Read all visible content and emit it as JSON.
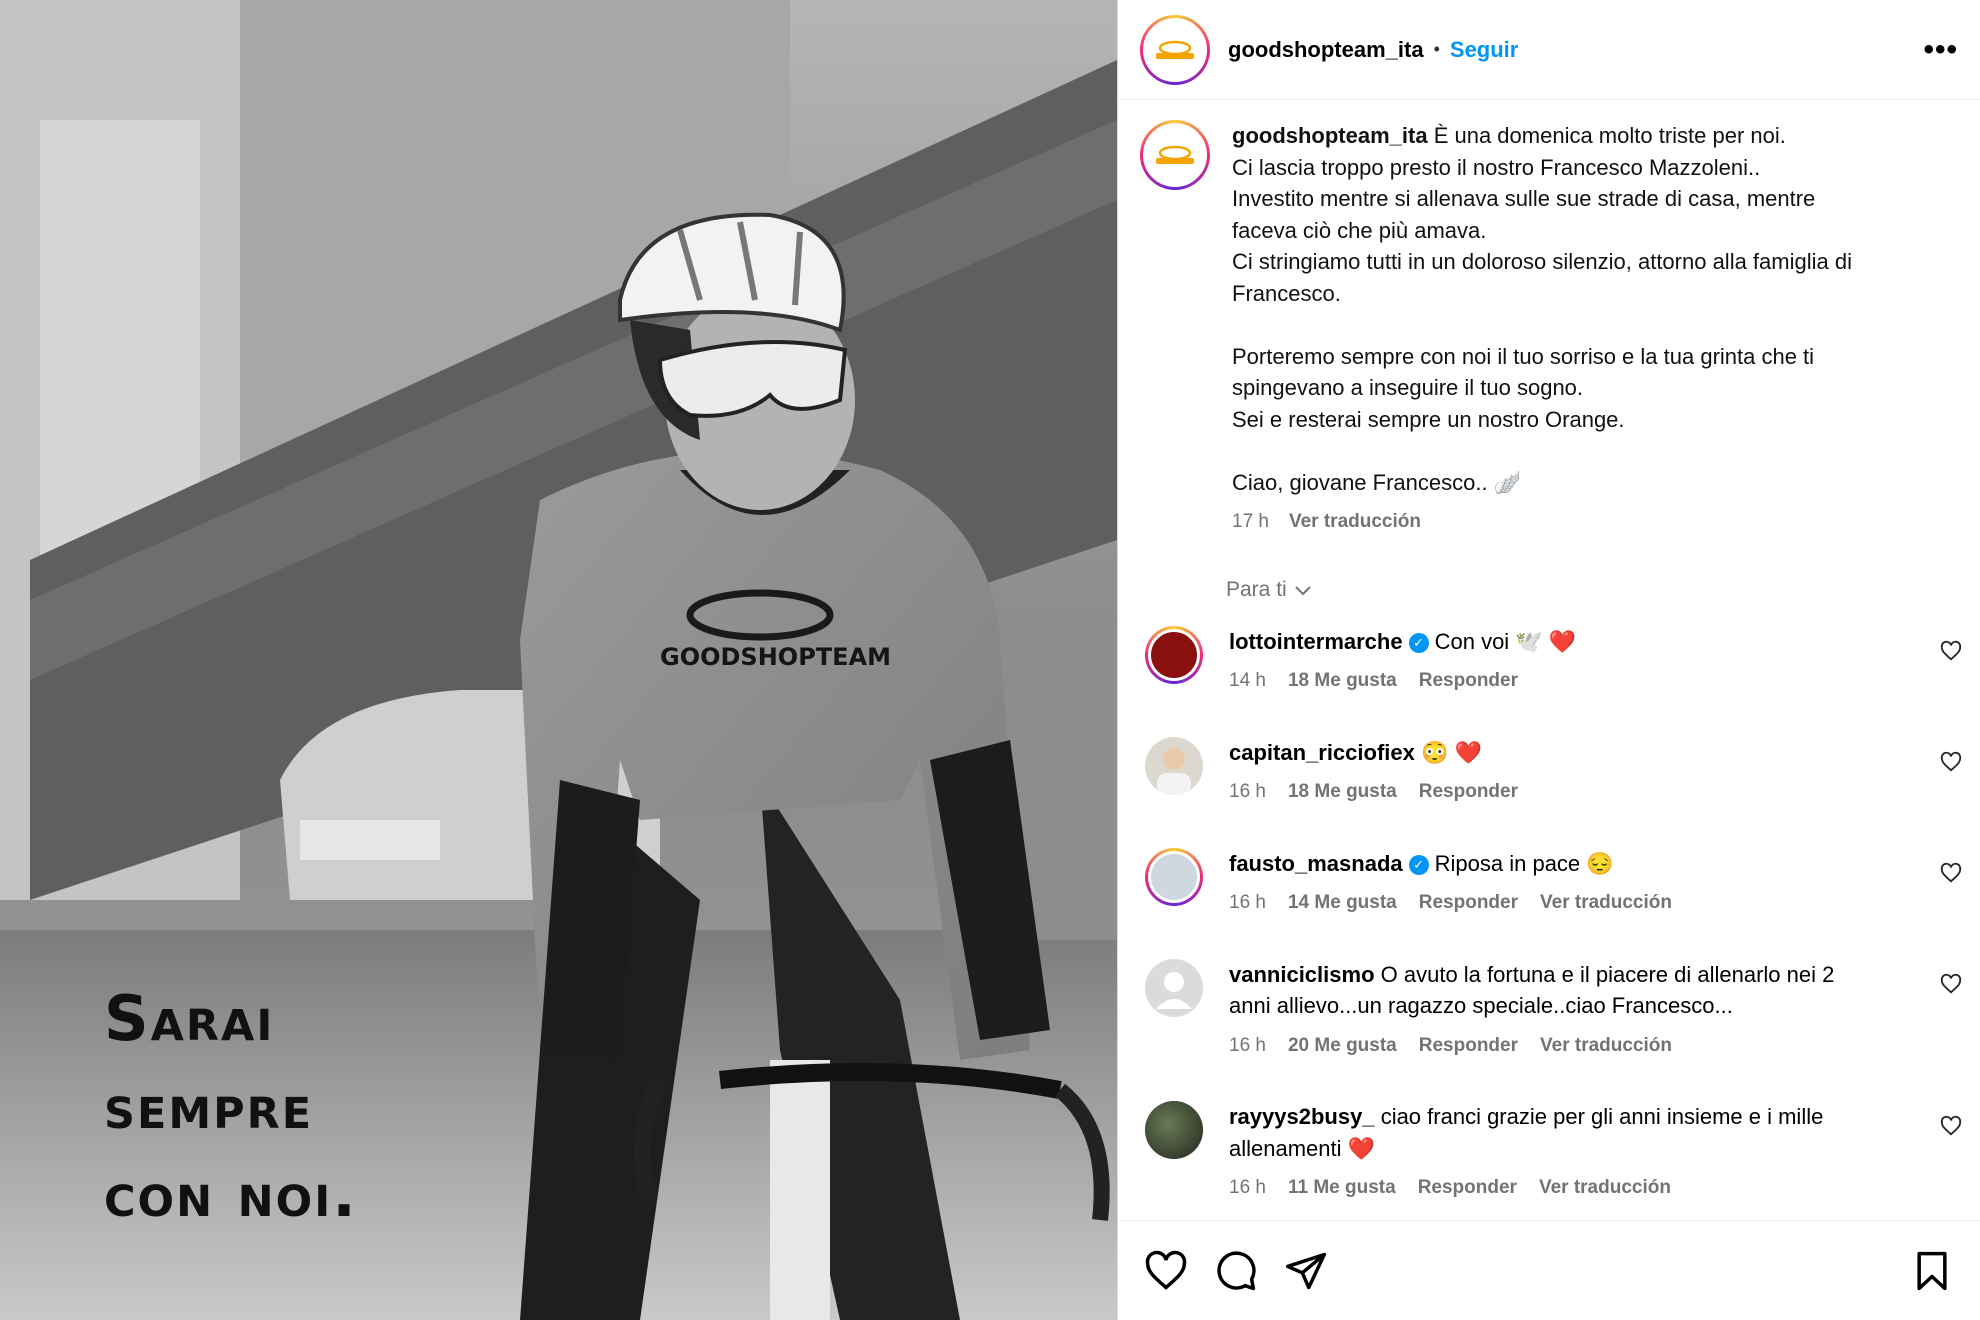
{
  "post": {
    "overlay_lines": [
      "Sarai",
      "sempre",
      "con noi."
    ]
  },
  "header": {
    "username": "goodshopteam_ita",
    "separator": "•",
    "follow_label": "Seguir",
    "more_label": "•••"
  },
  "caption": {
    "username": "goodshopteam_ita",
    "lines": [
      "È una domenica molto triste per noi.",
      "Ci lascia troppo presto il nostro Francesco Mazzoleni..",
      "Investito mentre si allenava sulle sue strade di casa, mentre",
      "faceva ciò che più amava.",
      "Ci stringiamo tutti in un doloroso silenzio, attorno alla famiglia di",
      "Francesco.",
      "",
      "Porteremo sempre con noi il tuo sorriso e la tua grinta che ti",
      "spingevano a inseguire il tuo sogno.",
      "Sei e resterai sempre un nostro Orange.",
      "",
      "Ciao, giovane Francesco.. 🪽"
    ],
    "time": "17 h",
    "translate_label": "Ver traducción"
  },
  "filter": {
    "label": "Para ti"
  },
  "comments": [
    {
      "username": "lottointermarche",
      "verified": true,
      "text": "Con voi 🕊️ ❤️",
      "text_cont": "",
      "time": "14 h",
      "likes": "18 Me gusta",
      "reply": "Responder",
      "translate": ""
    },
    {
      "username": "capitan_ricciofiex",
      "verified": false,
      "text": "😳 ❤️",
      "text_cont": "",
      "time": "16 h",
      "likes": "18 Me gusta",
      "reply": "Responder",
      "translate": ""
    },
    {
      "username": "fausto_masnada",
      "verified": true,
      "text": "Riposa in pace 😔",
      "text_cont": "",
      "time": "16 h",
      "likes": "14 Me gusta",
      "reply": "Responder",
      "translate": "Ver traducción"
    },
    {
      "username": "vanniciclismo",
      "verified": false,
      "text": "O avuto la fortuna e il piacere di allenarlo nei 2",
      "text_cont": "anni allievo...un ragazzo speciale..ciao Francesco...",
      "time": "16 h",
      "likes": "20 Me gusta",
      "reply": "Responder",
      "translate": "Ver traducción"
    },
    {
      "username": "rayyys2busy_",
      "verified": false,
      "text": "ciao franci grazie per gli anni insieme e i mille",
      "text_cont": "allenamenti ❤️",
      "time": "16 h",
      "likes": "11 Me gusta",
      "reply": "Responder",
      "translate": "Ver traducción"
    }
  ],
  "icons": {
    "like": "heart-icon",
    "comment": "comment-icon",
    "share": "share-icon",
    "save": "bookmark-icon",
    "more": "more-icon",
    "chevron": "chevron-down-icon"
  },
  "colors": {
    "link": "#0095f6",
    "muted": "#737373",
    "heart": "#ed4956"
  }
}
